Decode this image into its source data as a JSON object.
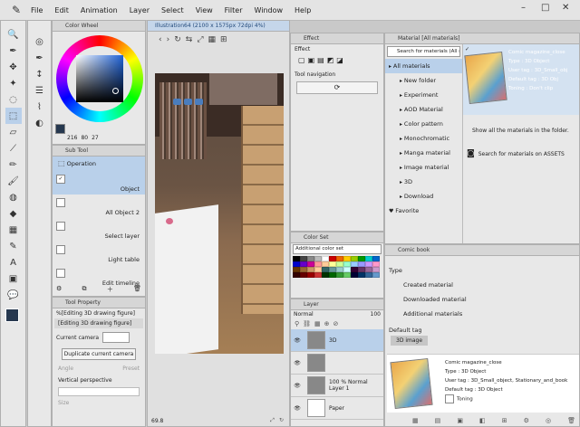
{
  "menu": [
    "File",
    "Edit",
    "Animation",
    "Layer",
    "Select",
    "View",
    "Filter",
    "Window",
    "Help"
  ],
  "window_controls": [
    "–",
    "□",
    "✕"
  ],
  "color_wheel": {
    "tab": "Color Wheel",
    "h": "216",
    "s": "80",
    "v": "27"
  },
  "canvas": {
    "tab": "Illustration64 (2100 x 1575px 72dpi 4%)",
    "zoom": "69.8"
  },
  "subtool": {
    "tab": "Sub Tool",
    "title": "Operation",
    "items": [
      {
        "label": "Object",
        "selected": true,
        "checked": true
      },
      {
        "label": "All Object 2",
        "selected": false,
        "checked": false
      },
      {
        "label": "Select layer",
        "selected": false,
        "checked": false
      },
      {
        "label": "Light table",
        "selected": false,
        "checked": false
      },
      {
        "label": "Edit timeline",
        "selected": false,
        "checked": false
      }
    ]
  },
  "tool_property": {
    "tab": "Tool Property",
    "header": "%[Editing 3D drawing figure]",
    "row_header": "[Editing 3D drawing figure]",
    "current_camera_label": "Current camera",
    "duplicate_camera": "Duplicate current camera",
    "angle_label": "Angle",
    "preset_label": "Preset",
    "vertical_perspective": "Vertical perspective",
    "size_label": "Size"
  },
  "effect": {
    "tab": "Effect",
    "title": "Effect",
    "nav_title": "Tool navigation"
  },
  "color_set": {
    "tab": "Color Set",
    "dropdown": "Additional color set"
  },
  "layer_panel": {
    "tab": "Layer",
    "blend": "Normal",
    "opacity": "100",
    "layers": [
      {
        "name": "3D",
        "info": ""
      },
      {
        "name": "",
        "info": ""
      },
      {
        "name": "Layer 1",
        "info": "100 % Normal"
      },
      {
        "name": "Paper",
        "info": ""
      }
    ]
  },
  "materials": {
    "tab": "Material [All materials]",
    "search_placeholder": "Search for materials (All m",
    "tree": [
      {
        "label": "All materials",
        "selected": true,
        "indent": 0
      },
      {
        "label": "New folder",
        "selected": false,
        "indent": 1
      },
      {
        "label": "Experiment",
        "selected": false,
        "indent": 1
      },
      {
        "label": "AOD Material",
        "selected": false,
        "indent": 1
      },
      {
        "label": "Color pattern",
        "selected": false,
        "indent": 1
      },
      {
        "label": "Monochromatic",
        "selected": false,
        "indent": 1
      },
      {
        "label": "Manga material",
        "selected": false,
        "indent": 1
      },
      {
        "label": "Image material",
        "selected": false,
        "indent": 1
      },
      {
        "label": "3D",
        "selected": false,
        "indent": 1
      },
      {
        "label": "Download",
        "selected": false,
        "indent": 1
      },
      {
        "label": "Favorite",
        "selected": false,
        "indent": 0
      }
    ],
    "item_title": "Comic magazine_close",
    "item_type": "Type : 3D Object",
    "item_usertag": "User tag : 3D_Small_obj",
    "item_default": "Default tag : 3D Obj",
    "item_toning": "Toning : Don't clip",
    "show_all": "Show all the materials in the folder.",
    "search_assets": "Search for materials on ASSETS"
  },
  "comic_book": {
    "tab": "Comic book",
    "type_label": "Type",
    "types": [
      "Created material",
      "Downloaded material",
      "Additional materials"
    ],
    "default_tag_label": "Default tag",
    "default_tag": "3D image",
    "detail_title": "Comic magazine_close",
    "detail_type": "Type : 3D Object",
    "detail_usertag": "User tag : 3D_Small_object, Stationary_and_book",
    "detail_default": "Default tag : 3D Object",
    "detail_toning": "Toning"
  },
  "colors": {
    "accent": "#3a6ea5",
    "selected_bg": "#b9d0ea",
    "panel_bg": "#e8e8e8"
  }
}
